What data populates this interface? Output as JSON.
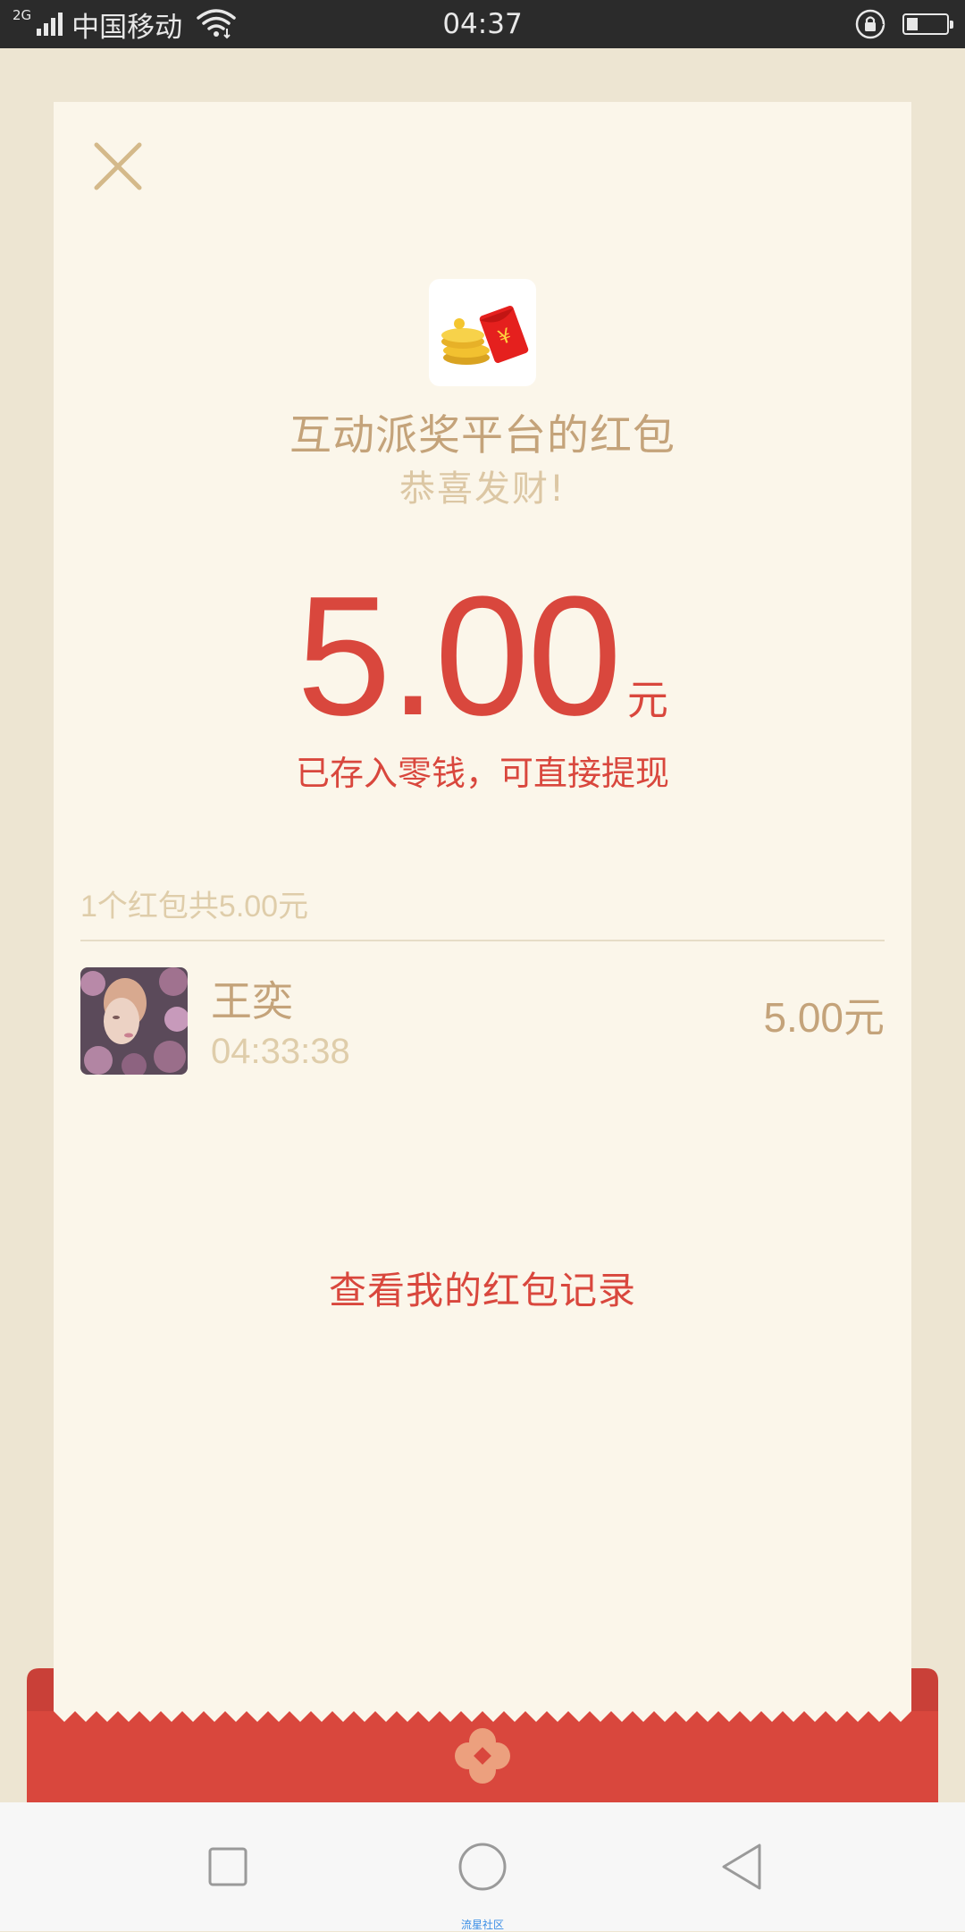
{
  "status_bar": {
    "network_type": "2G",
    "carrier": "中国移动",
    "time": "04:37"
  },
  "red_packet": {
    "sender_name": "互动派奖平台的红包",
    "greeting": "恭喜发财!",
    "amount": "5.00",
    "amount_unit": "元",
    "deposit_note": "已存入零钱，可直接提现",
    "summary": "1个红包共5.00元",
    "records": [
      {
        "name": "王奕",
        "time": "04:33:38",
        "amount": "5.00元"
      }
    ],
    "view_records_label": "查看我的红包记录"
  },
  "watermark": "流星社区",
  "colors": {
    "accent_red": "#d9473d",
    "gold_text": "#c4a37a",
    "light_gold_text": "#dfcdaa",
    "card_bg": "#fbf6ea",
    "page_bg": "#ede5d2"
  },
  "icons": [
    "signal-icon",
    "wifi-icon",
    "rotation-lock-icon",
    "battery-icon",
    "close-icon",
    "red-packet-logo",
    "flower-emblem-icon",
    "recent-apps-icon",
    "home-icon",
    "back-icon"
  ]
}
